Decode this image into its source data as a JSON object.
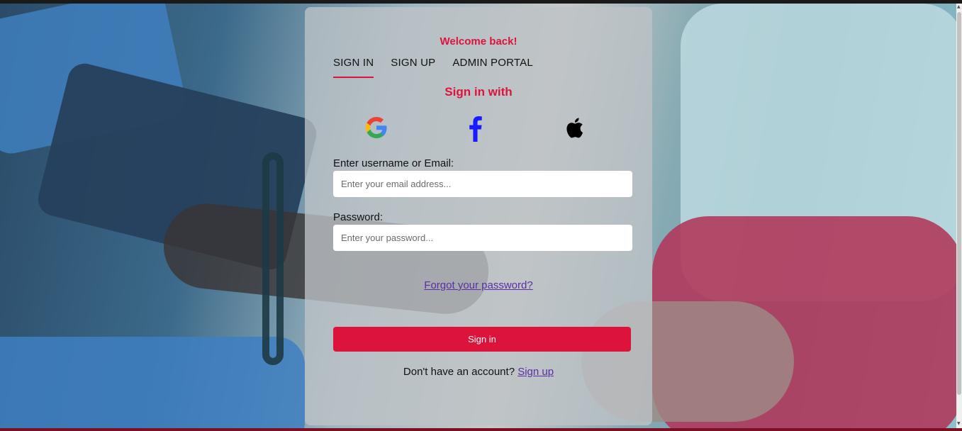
{
  "card": {
    "welcome": "Welcome back!",
    "tabs": [
      {
        "label": "SIGN IN",
        "active": true
      },
      {
        "label": "SIGN UP",
        "active": false
      },
      {
        "label": "ADMIN PORTAL",
        "active": false
      }
    ],
    "sign_in_with": "Sign in with",
    "social_icons": [
      "google-icon",
      "facebook-icon",
      "apple-icon"
    ],
    "username": {
      "label": "Enter username or Email:",
      "placeholder": "Enter your email address...",
      "value": ""
    },
    "password": {
      "label": "Password:",
      "placeholder": "Enter your password...",
      "value": ""
    },
    "forgot_label": "Forgot your password?",
    "signin_label": "Sign in",
    "footer_text": "Don't have an account?",
    "footer_link": "Sign up"
  },
  "colors": {
    "accent": "#dc143c",
    "link": "#5a2ea6",
    "facebook": "#1a1aff"
  }
}
